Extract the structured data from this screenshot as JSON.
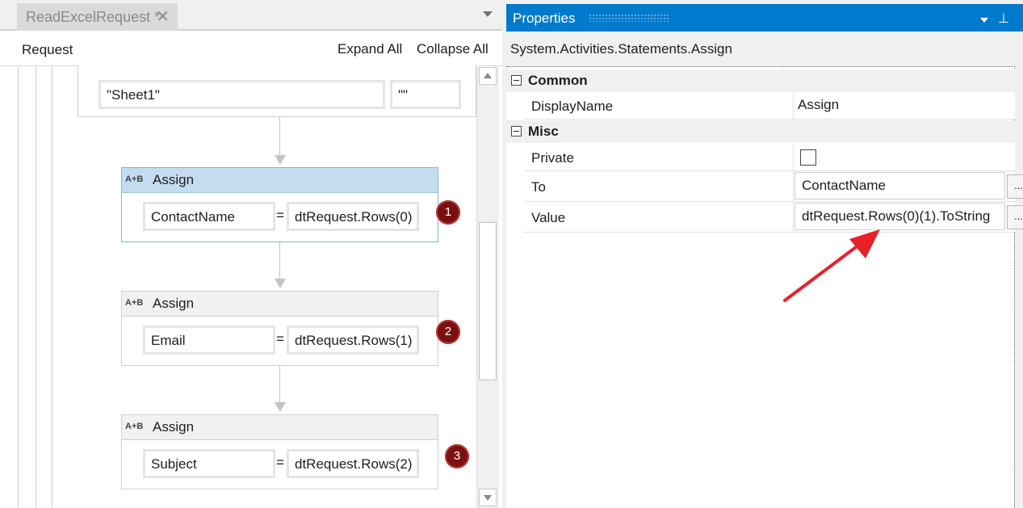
{
  "designer": {
    "tab_title": "ReadExcelRequest *",
    "tab_close": "✕",
    "breadcrumb": "Request",
    "expand_all": "Expand All",
    "collapse_all": "Collapse All",
    "prev_activity": {
      "sheet_value": "\"Sheet1\"",
      "range_value": "\"\""
    },
    "activities": [
      {
        "icon": "A+B",
        "title": "Assign",
        "to": "ContactName",
        "equals": "=",
        "value": "dtRequest.Rows(0)",
        "badge": "1",
        "selected": true
      },
      {
        "icon": "A+B",
        "title": "Assign",
        "to": "Email",
        "equals": "=",
        "value": "dtRequest.Rows(1)",
        "badge": "2",
        "selected": false
      },
      {
        "icon": "A+B",
        "title": "Assign",
        "to": "Subject",
        "equals": "=",
        "value": "dtRequest.Rows(2)",
        "badge": "3",
        "selected": false
      }
    ]
  },
  "properties": {
    "title": "Properties",
    "type_name": "System.Activities.Statements.Assign",
    "categories": {
      "common": "Common",
      "misc": "Misc"
    },
    "rows": {
      "display_name": {
        "label": "DisplayName",
        "value": "Assign"
      },
      "private": {
        "label": "Private",
        "checked": false
      },
      "to": {
        "label": "To",
        "value": "ContactName",
        "button": "..."
      },
      "value": {
        "label": "Value",
        "value": "dtRequest.Rows(0)(1).ToString",
        "button": "..."
      }
    }
  },
  "colors": {
    "accent": "#007acc",
    "selected_header": "#c3dcf0",
    "badge": "#7b1010",
    "annotation_arrow": "#e8202a"
  },
  "icons": [
    "close-icon",
    "dropdown-icon",
    "pin-icon",
    "assign-icon",
    "collapse-icon",
    "scroll-up-icon",
    "scroll-down-icon"
  ]
}
